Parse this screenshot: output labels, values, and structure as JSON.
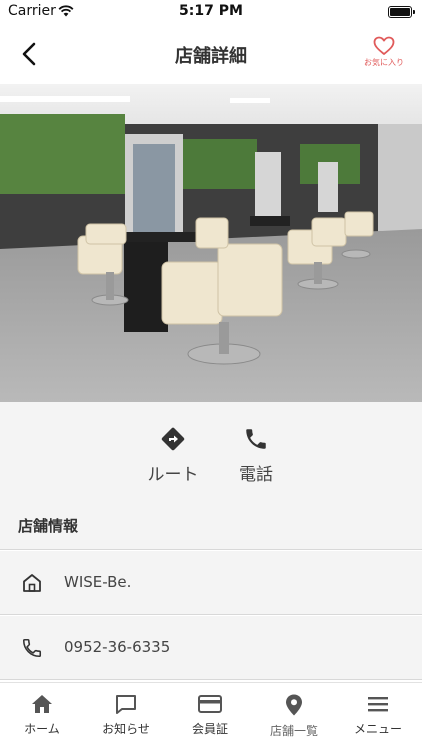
{
  "status_bar": {
    "carrier": "Carrier",
    "time": "5:17 PM"
  },
  "nav": {
    "title": "店舗詳細",
    "favorite_label": "お気に入り"
  },
  "hero": {
    "image_icon": "salon-interior-photo"
  },
  "actions": {
    "route_label": "ルート",
    "phone_label": "電話"
  },
  "shop_info": {
    "title": "店舗情報",
    "name": "WISE-Be.",
    "phone": "0952-36-6335"
  },
  "tabs": [
    {
      "label": "ホーム",
      "icon": "home-icon"
    },
    {
      "label": "お知らせ",
      "icon": "message-icon"
    },
    {
      "label": "会員証",
      "icon": "card-icon"
    },
    {
      "label": "店舗一覧",
      "icon": "map-pin-icon"
    },
    {
      "label": "メニュー",
      "icon": "menu-icon"
    }
  ],
  "colors": {
    "accent_favorite": "#e05a5a",
    "background": "#f4f4f4"
  }
}
